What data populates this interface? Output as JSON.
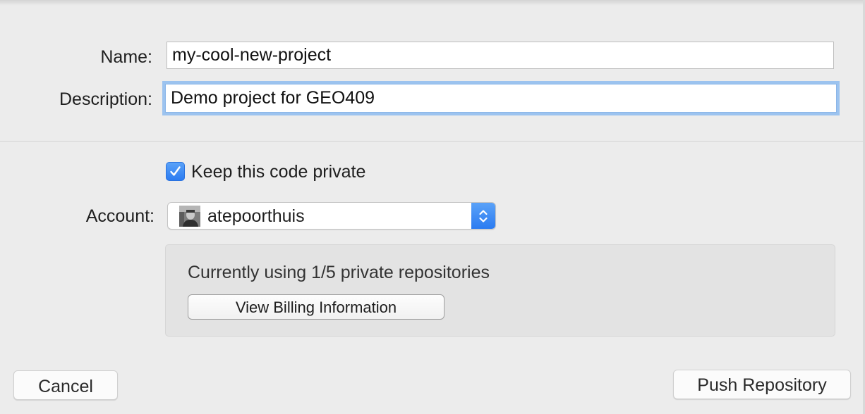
{
  "form": {
    "name_label": "Name:",
    "name_value": "my-cool-new-project",
    "description_label": "Description:",
    "description_value": "Demo project for GEO409"
  },
  "privacy": {
    "checked": true,
    "label": "Keep this code private"
  },
  "account": {
    "label": "Account:",
    "selected": "atepoorthuis",
    "avatar_icon": "user-avatar"
  },
  "info": {
    "usage_text": "Currently using 1/5 private repositories",
    "billing_button_label": "View Billing Information"
  },
  "footer": {
    "cancel_label": "Cancel",
    "push_label": "Push Repository"
  },
  "colors": {
    "accent": "#2f80f2",
    "focus_ring": "#9cc3ef",
    "background": "#ececec"
  }
}
